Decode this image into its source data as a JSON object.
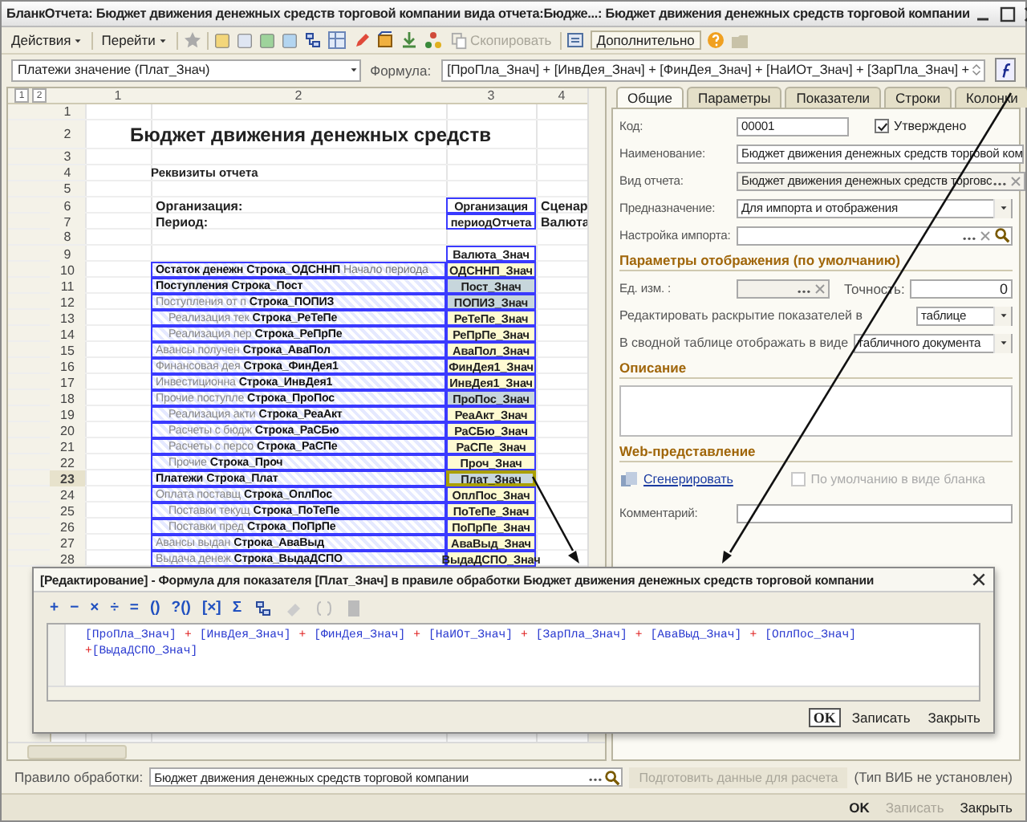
{
  "window": {
    "title": "БланкОтчета: Бюджет движения денежных средств торговой компании вида отчета:Бюдже...: Бюджет движения денежных средств торговой компании"
  },
  "toolbar": {
    "menus": [
      "Действия",
      "Перейти"
    ],
    "copy_button": {
      "label": "Скопировать",
      "disabled": true
    },
    "more_button": "Дополнительно"
  },
  "formula_bar": {
    "indicator": "Платежи значение (Плат_Знач)",
    "formula_label": "Формула:",
    "formula": "[ПроПла_Знач] + [ИнвДея_Знач] + [ФинДея_Знач] + [НаИОт_Знач] + [ЗарПла_Знач] +"
  },
  "sheet": {
    "outline_buttons": [
      "1",
      "2"
    ],
    "columns": [
      "1",
      "2",
      "3",
      "4"
    ],
    "rows": [
      {
        "num": "1",
        "kind": "blank",
        "selected": false
      },
      {
        "num": "2",
        "kind": "title",
        "text": "Бюджет движения денежных средств",
        "selected": false
      },
      {
        "num": "3",
        "kind": "blank",
        "selected": false
      },
      {
        "num": "4",
        "kind": "heading",
        "text": "Реквизиты отчета",
        "selected": false
      },
      {
        "num": "5",
        "kind": "blank",
        "selected": false
      },
      {
        "num": "6",
        "kind": "param",
        "label": "Организация:",
        "param": "Организация",
        "extra": "Сценар",
        "selected": false
      },
      {
        "num": "7",
        "kind": "param",
        "label": "Период:",
        "param": "периодОтчета",
        "extra": "Валюта",
        "selected": false
      },
      {
        "num": "8",
        "kind": "blank",
        "selected": false
      },
      {
        "num": "9",
        "kind": "param",
        "param": "Валюта_Знач",
        "selected": false
      },
      {
        "num": "10",
        "kind": "group",
        "label": "Остаток денежн",
        "code": "Строка_ОДСННП",
        "note": "Начало периода",
        "value": "ОДСННП_Знач",
        "shaded": false,
        "selected": false
      },
      {
        "num": "11",
        "kind": "group",
        "label": "Поступления",
        "code": "Строка_Пост",
        "value": "Пост_Знач",
        "shaded": true,
        "selected": false
      },
      {
        "num": "12",
        "kind": "item",
        "label": "Поступления от п",
        "code": "Строка_ПОПИЗ",
        "value": "ПОПИЗ_Знач",
        "shaded": true,
        "selected": false
      },
      {
        "num": "13",
        "kind": "subitem",
        "label": "Реализация тек",
        "code": "Строка_РеТеПе",
        "value": "РеТеПе_Знач",
        "shaded": false,
        "selected": false
      },
      {
        "num": "14",
        "kind": "subitem",
        "label": "Реализация пер",
        "code": "Строка_РеПрПе",
        "value": "РеПрПе_Знач",
        "shaded": false,
        "selected": false
      },
      {
        "num": "15",
        "kind": "item",
        "label": "Авансы получен",
        "code": "Строка_АваПол",
        "value": "АваПол_Знач",
        "shaded": false,
        "selected": false
      },
      {
        "num": "16",
        "kind": "item",
        "label": "Финансовая дея",
        "code": "Строка_ФинДея1",
        "value": "ФинДея1_Знач",
        "shaded": false,
        "selected": false
      },
      {
        "num": "17",
        "kind": "item",
        "label": "Инвестиционна",
        "code": "Строка_ИнвДея1",
        "value": "ИнвДея1_Знач",
        "shaded": false,
        "selected": false
      },
      {
        "num": "18",
        "kind": "item",
        "label": "Прочие поступле",
        "code": "Строка_ПроПос",
        "value": "ПроПос_Знач",
        "shaded": true,
        "selected": false
      },
      {
        "num": "19",
        "kind": "subitem",
        "label": "Реализация акти",
        "code": "Строка_РеаАкт",
        "value": "РеаАкт_Знач",
        "shaded": false,
        "selected": false
      },
      {
        "num": "20",
        "kind": "subitem",
        "label": "Расчеты с бюдж",
        "code": "Строка_РаСБю",
        "value": "РаСБю_Знач",
        "shaded": false,
        "selected": false
      },
      {
        "num": "21",
        "kind": "subitem",
        "label": "Расчеты с персо",
        "code": "Строка_РаСПе",
        "value": "РаСПе_Знач",
        "shaded": false,
        "selected": false
      },
      {
        "num": "22",
        "kind": "subitem",
        "label": "Прочие",
        "code": "Строка_Проч",
        "value": "Проч_Знач",
        "shaded": false,
        "selected": false
      },
      {
        "num": "23",
        "kind": "group",
        "label": "Платежи",
        "code": "Строка_Плат",
        "value": "Плат_Знач",
        "shaded": true,
        "selected": true
      },
      {
        "num": "24",
        "kind": "item",
        "label": "Оплата поставщ",
        "code": "Строка_ОплПос",
        "value": "ОплПос_Знач",
        "shaded": false,
        "selected": false
      },
      {
        "num": "25",
        "kind": "subitem",
        "label": "Поставки текущ",
        "code": "Строка_ПоТеПе",
        "value": "ПоТеПе_Знач",
        "shaded": false,
        "selected": false
      },
      {
        "num": "26",
        "kind": "subitem",
        "label": "Поставки пред",
        "code": "Строка_ПоПрПе",
        "value": "ПоПрПе_Знач",
        "shaded": false,
        "selected": false
      },
      {
        "num": "27",
        "kind": "item",
        "label": "Авансы выдан",
        "code": "Строка_АваВыд",
        "value": "АваВыд_Знач",
        "shaded": false,
        "selected": false
      },
      {
        "num": "28",
        "kind": "item",
        "label": "Выдача денеж",
        "code": "Строка_ВыдаДСПО",
        "value": "ВыдаДСПО_Знач",
        "shaded": false,
        "selected": false
      }
    ]
  },
  "tabs": [
    {
      "label": "Общие",
      "selected": true
    },
    {
      "label": "Параметры",
      "selected": false
    },
    {
      "label": "Показатели",
      "selected": false
    },
    {
      "label": "Строки",
      "selected": false
    },
    {
      "label": "Колонки",
      "selected": false
    }
  ],
  "general": {
    "code": {
      "label": "Код:",
      "value": "00001"
    },
    "approved": {
      "label": "Утверждено",
      "checked": true
    },
    "name": {
      "label": "Наименование:",
      "value": "Бюджет движения денежных средств торговой ком"
    },
    "report_kind": {
      "label": "Вид отчета:",
      "value": "Бюджет движения денежных средств торговс"
    },
    "purpose": {
      "label": "Предназначение:",
      "value": "Для импорта и отображения"
    },
    "import_setting": {
      "label": "Настройка импорта:"
    },
    "display_section": "Параметры отображения (по умолчанию)",
    "unit": {
      "label": "Ед. изм. :"
    },
    "precision": {
      "label": "Точность:",
      "value": "0"
    },
    "expand_in": {
      "label": "Редактировать раскрытие показателей в",
      "value": "таблице"
    },
    "pivot_view": {
      "label": "В сводной таблице отображать в виде",
      "value": "табличного документа"
    },
    "description_section": "Описание",
    "web_section": "Web-представление",
    "generate_link": "Сгенерировать",
    "default_blank": {
      "label": "По умолчанию в виде бланка",
      "checked": false,
      "disabled": true
    },
    "comment": {
      "label": "Комментарий:"
    }
  },
  "dialog": {
    "title": "[Редактирование] - Формула для показателя [Плат_Знач] в правиле обработки Бюджет движения денежных средств торговой компании",
    "operators": [
      "+",
      "−",
      "×",
      "÷",
      "=",
      "()",
      "?()",
      "[×]",
      "Σ"
    ],
    "lines": [
      [
        {
          "kind": "ref",
          "text": "[ПроПла_Знач]"
        },
        {
          "kind": "op",
          "text": "+"
        },
        {
          "kind": "ref",
          "text": "[ИнвДея_Знач]"
        },
        {
          "kind": "op",
          "text": "+"
        },
        {
          "kind": "ref",
          "text": "[ФинДея_Знач]"
        },
        {
          "kind": "op",
          "text": "+"
        },
        {
          "kind": "ref",
          "text": "[НаИОт_Знач]"
        },
        {
          "kind": "op",
          "text": "+"
        },
        {
          "kind": "ref",
          "text": "[ЗарПла_Знач]"
        },
        {
          "kind": "op",
          "text": "+"
        },
        {
          "kind": "ref",
          "text": "[АваВыд_Знач]"
        },
        {
          "kind": "op",
          "text": "+"
        },
        {
          "kind": "ref",
          "text": "[ОплПос_Знач]"
        }
      ],
      [
        {
          "kind": "op",
          "text": "+"
        },
        {
          "kind": "ref",
          "text": "[ВыдаДСПО_Знач]"
        }
      ]
    ],
    "buttons": [
      {
        "label": "OK",
        "default": true,
        "disabled": false
      },
      {
        "label": "Записать",
        "default": false,
        "disabled": false
      },
      {
        "label": "Закрыть",
        "default": false,
        "disabled": false
      }
    ]
  },
  "rule": {
    "label": "Правило обработки:",
    "value": "Бюджет движения денежных средств торговой компании",
    "prepare_button": {
      "label": "Подготовить данные для расчета",
      "disabled": true
    },
    "note": "(Тип ВИБ не установлен)"
  },
  "buttons": [
    {
      "label": "OK",
      "default": true,
      "disabled": false
    },
    {
      "label": "Записать",
      "default": false,
      "disabled": true
    },
    {
      "label": "Закрыть",
      "default": false,
      "disabled": false
    }
  ]
}
